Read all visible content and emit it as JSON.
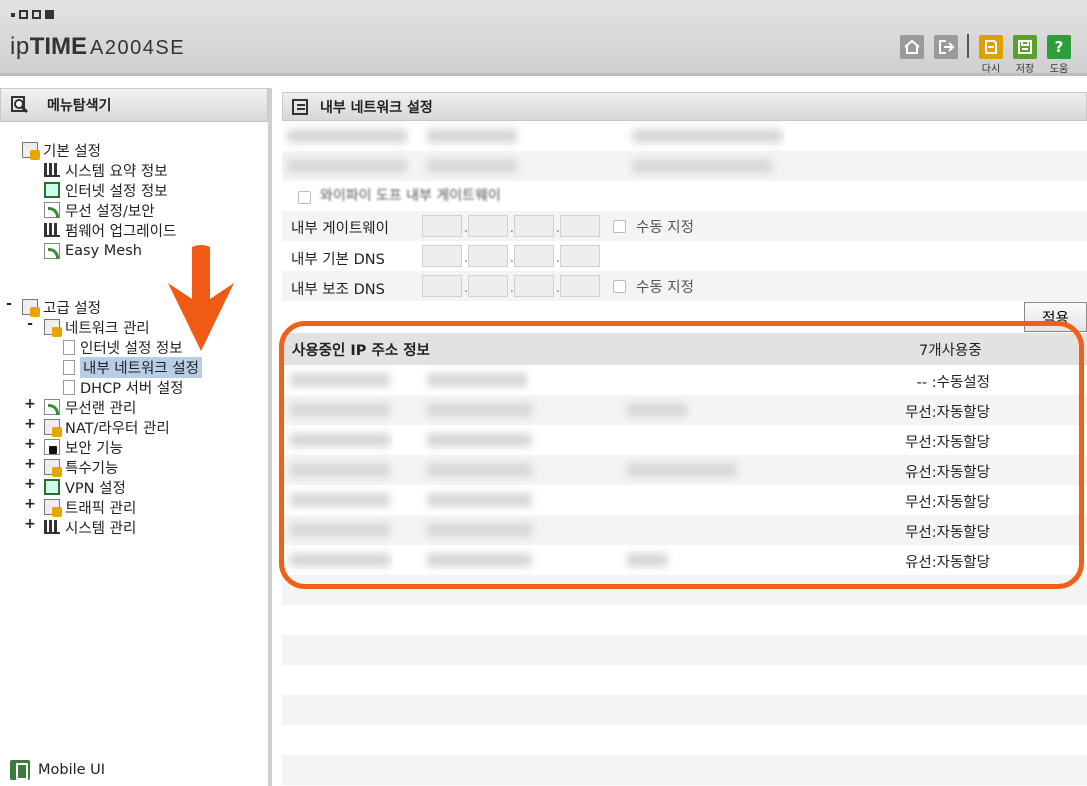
{
  "header": {
    "brand_ip": "ip",
    "brand_time": "TIME",
    "model": "A2004SE",
    "buttons": {
      "home_icon": "home-icon",
      "logout_icon": "logout-icon",
      "reload_label": "다시",
      "save_label": "저장",
      "help_label": "도움",
      "help_glyph": "?"
    },
    "colors": {
      "reload": "#e0a000",
      "save": "#5aa02c",
      "help": "#2e9e3a",
      "home": "#9a9a9a"
    }
  },
  "sidebar": {
    "title": "메뉴탐색기",
    "basic": {
      "label": "기본 설정",
      "items": [
        "시스템 요약 정보",
        "인터넷 설정 정보",
        "무선 설정/보안",
        "펌웨어 업그레이드",
        "Easy Mesh"
      ]
    },
    "advanced": {
      "label": "고급 설정",
      "expand_sign": "-",
      "network": {
        "label": "네트워크 관리",
        "expand_sign": "-",
        "items": [
          "인터넷 설정 정보",
          "내부 네트워크 설정",
          "DHCP 서버 설정"
        ],
        "selected_index": 1
      },
      "groups": [
        {
          "label": "무선랜 관리",
          "sign": "+"
        },
        {
          "label": "NAT/라우터 관리",
          "sign": "+"
        },
        {
          "label": "보안 기능",
          "sign": "+"
        },
        {
          "label": "특수기능",
          "sign": "+"
        },
        {
          "label": "VPN 설정",
          "sign": "+"
        },
        {
          "label": "트래픽 관리",
          "sign": "+"
        },
        {
          "label": "시스템 관리",
          "sign": "+"
        }
      ]
    },
    "mobile_ui": "Mobile UI"
  },
  "main": {
    "title": "내부 네트워크 설정",
    "partial_row": "와이파이 도프 내부 게이트웨이",
    "fields": [
      {
        "label": "내부 게이트웨이",
        "manual": "수동 지정"
      },
      {
        "label": "내부 기본 DNS",
        "manual": ""
      },
      {
        "label": "내부 보조 DNS",
        "manual": "수동 지정"
      }
    ],
    "apply": "적용",
    "ip_section": {
      "title": "사용중인 IP 주소 정보",
      "count": "7개사용중",
      "rows": [
        "-- :수동설정",
        "무선:자동할당",
        "무선:자동할당",
        "유선:자동할당",
        "무선:자동할당",
        "무선:자동할당",
        "유선:자동할당"
      ]
    }
  },
  "annotation": {
    "highlight_color": "#f0601a",
    "arrow_color": "#f05a14"
  }
}
